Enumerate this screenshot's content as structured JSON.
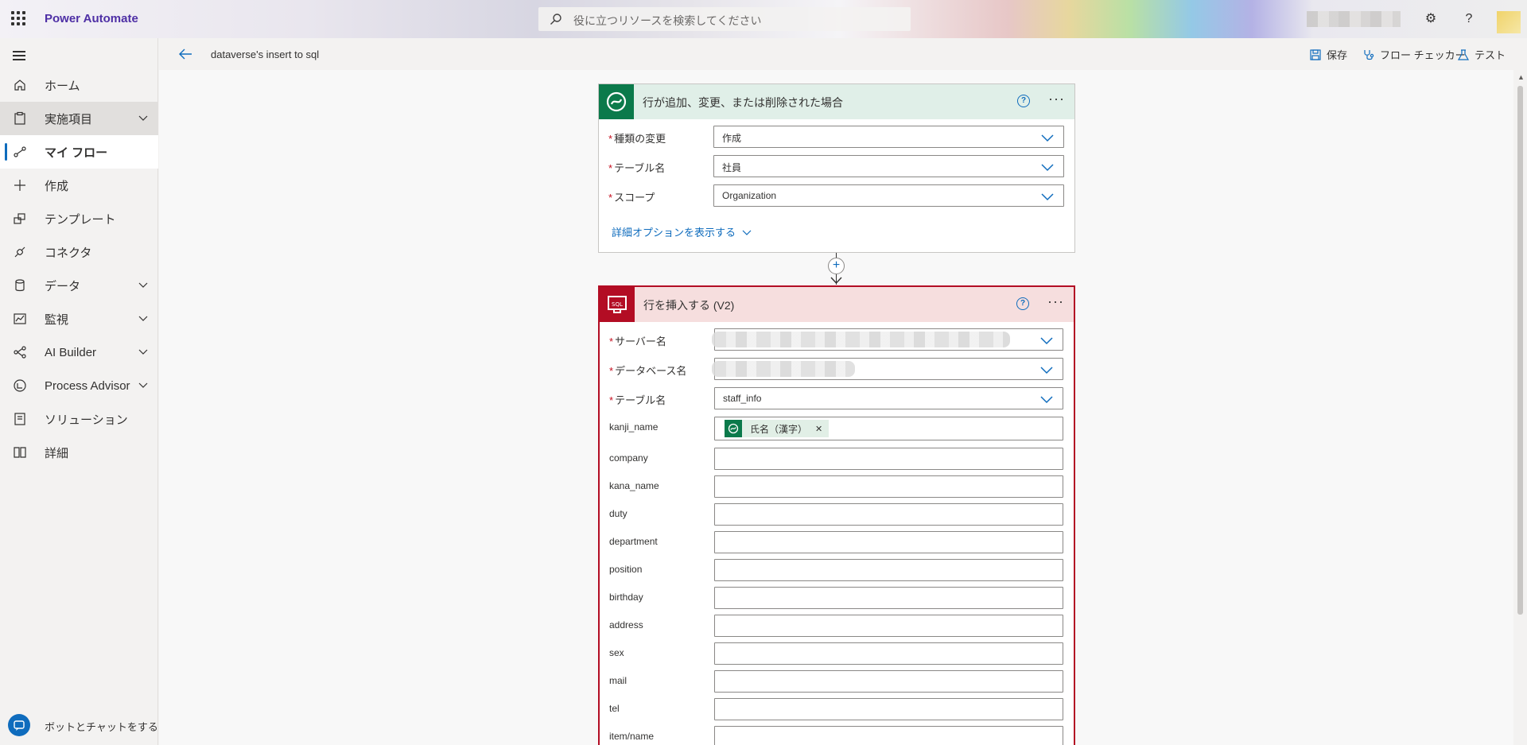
{
  "app": {
    "brand": "Power Automate",
    "search_placeholder": "役に立つリソースを検索してください"
  },
  "colors": {
    "brand": "#4e2fa5",
    "accent": "#0f6cbd",
    "dataverse": "#0b7a4b",
    "sql": "#b30d24",
    "required": "#c50f1f"
  },
  "nav": {
    "items": [
      {
        "label": "ホーム",
        "icon": "home-icon"
      },
      {
        "label": "実施項目",
        "icon": "clipboard-icon",
        "expandable": true
      },
      {
        "label": "マイ フロー",
        "icon": "flow-icon",
        "selected": true
      },
      {
        "label": "作成",
        "icon": "plus-icon"
      },
      {
        "label": "テンプレート",
        "icon": "template-icon"
      },
      {
        "label": "コネクタ",
        "icon": "connector-icon"
      },
      {
        "label": "データ",
        "icon": "database-icon",
        "expandable": true
      },
      {
        "label": "監視",
        "icon": "monitor-icon",
        "expandable": true
      },
      {
        "label": "AI Builder",
        "icon": "ai-builder-icon",
        "expandable": true
      },
      {
        "label": "Process Advisor",
        "icon": "process-advisor-icon",
        "expandable": true
      },
      {
        "label": "ソリューション",
        "icon": "solution-icon"
      },
      {
        "label": "詳細",
        "icon": "book-icon"
      }
    ],
    "chatbot": "ボットとチャットをする"
  },
  "command": {
    "flow_name": "dataverse's insert to sql",
    "save": "保存",
    "checker": "フロー チェッカー",
    "test": "テスト"
  },
  "trigger": {
    "title": "行が追加、変更、または削除された場合",
    "fields": [
      {
        "label": "種類の変更",
        "value": "作成"
      },
      {
        "label": "テーブル名",
        "value": "社員"
      },
      {
        "label": "スコープ",
        "value": "Organization"
      }
    ],
    "advanced": "詳細オプションを表示する"
  },
  "action": {
    "title": "行を挿入する (V2)",
    "server_label": "サーバー名",
    "database_label": "データベース名",
    "table_label": "テーブル名",
    "table_value": "staff_info",
    "token_field": "kanji_name",
    "token_value": "氏名（漢字）",
    "columns": [
      "company",
      "kana_name",
      "duty",
      "department",
      "position",
      "birthday",
      "address",
      "sex",
      "mail",
      "tel",
      "item/name"
    ]
  }
}
